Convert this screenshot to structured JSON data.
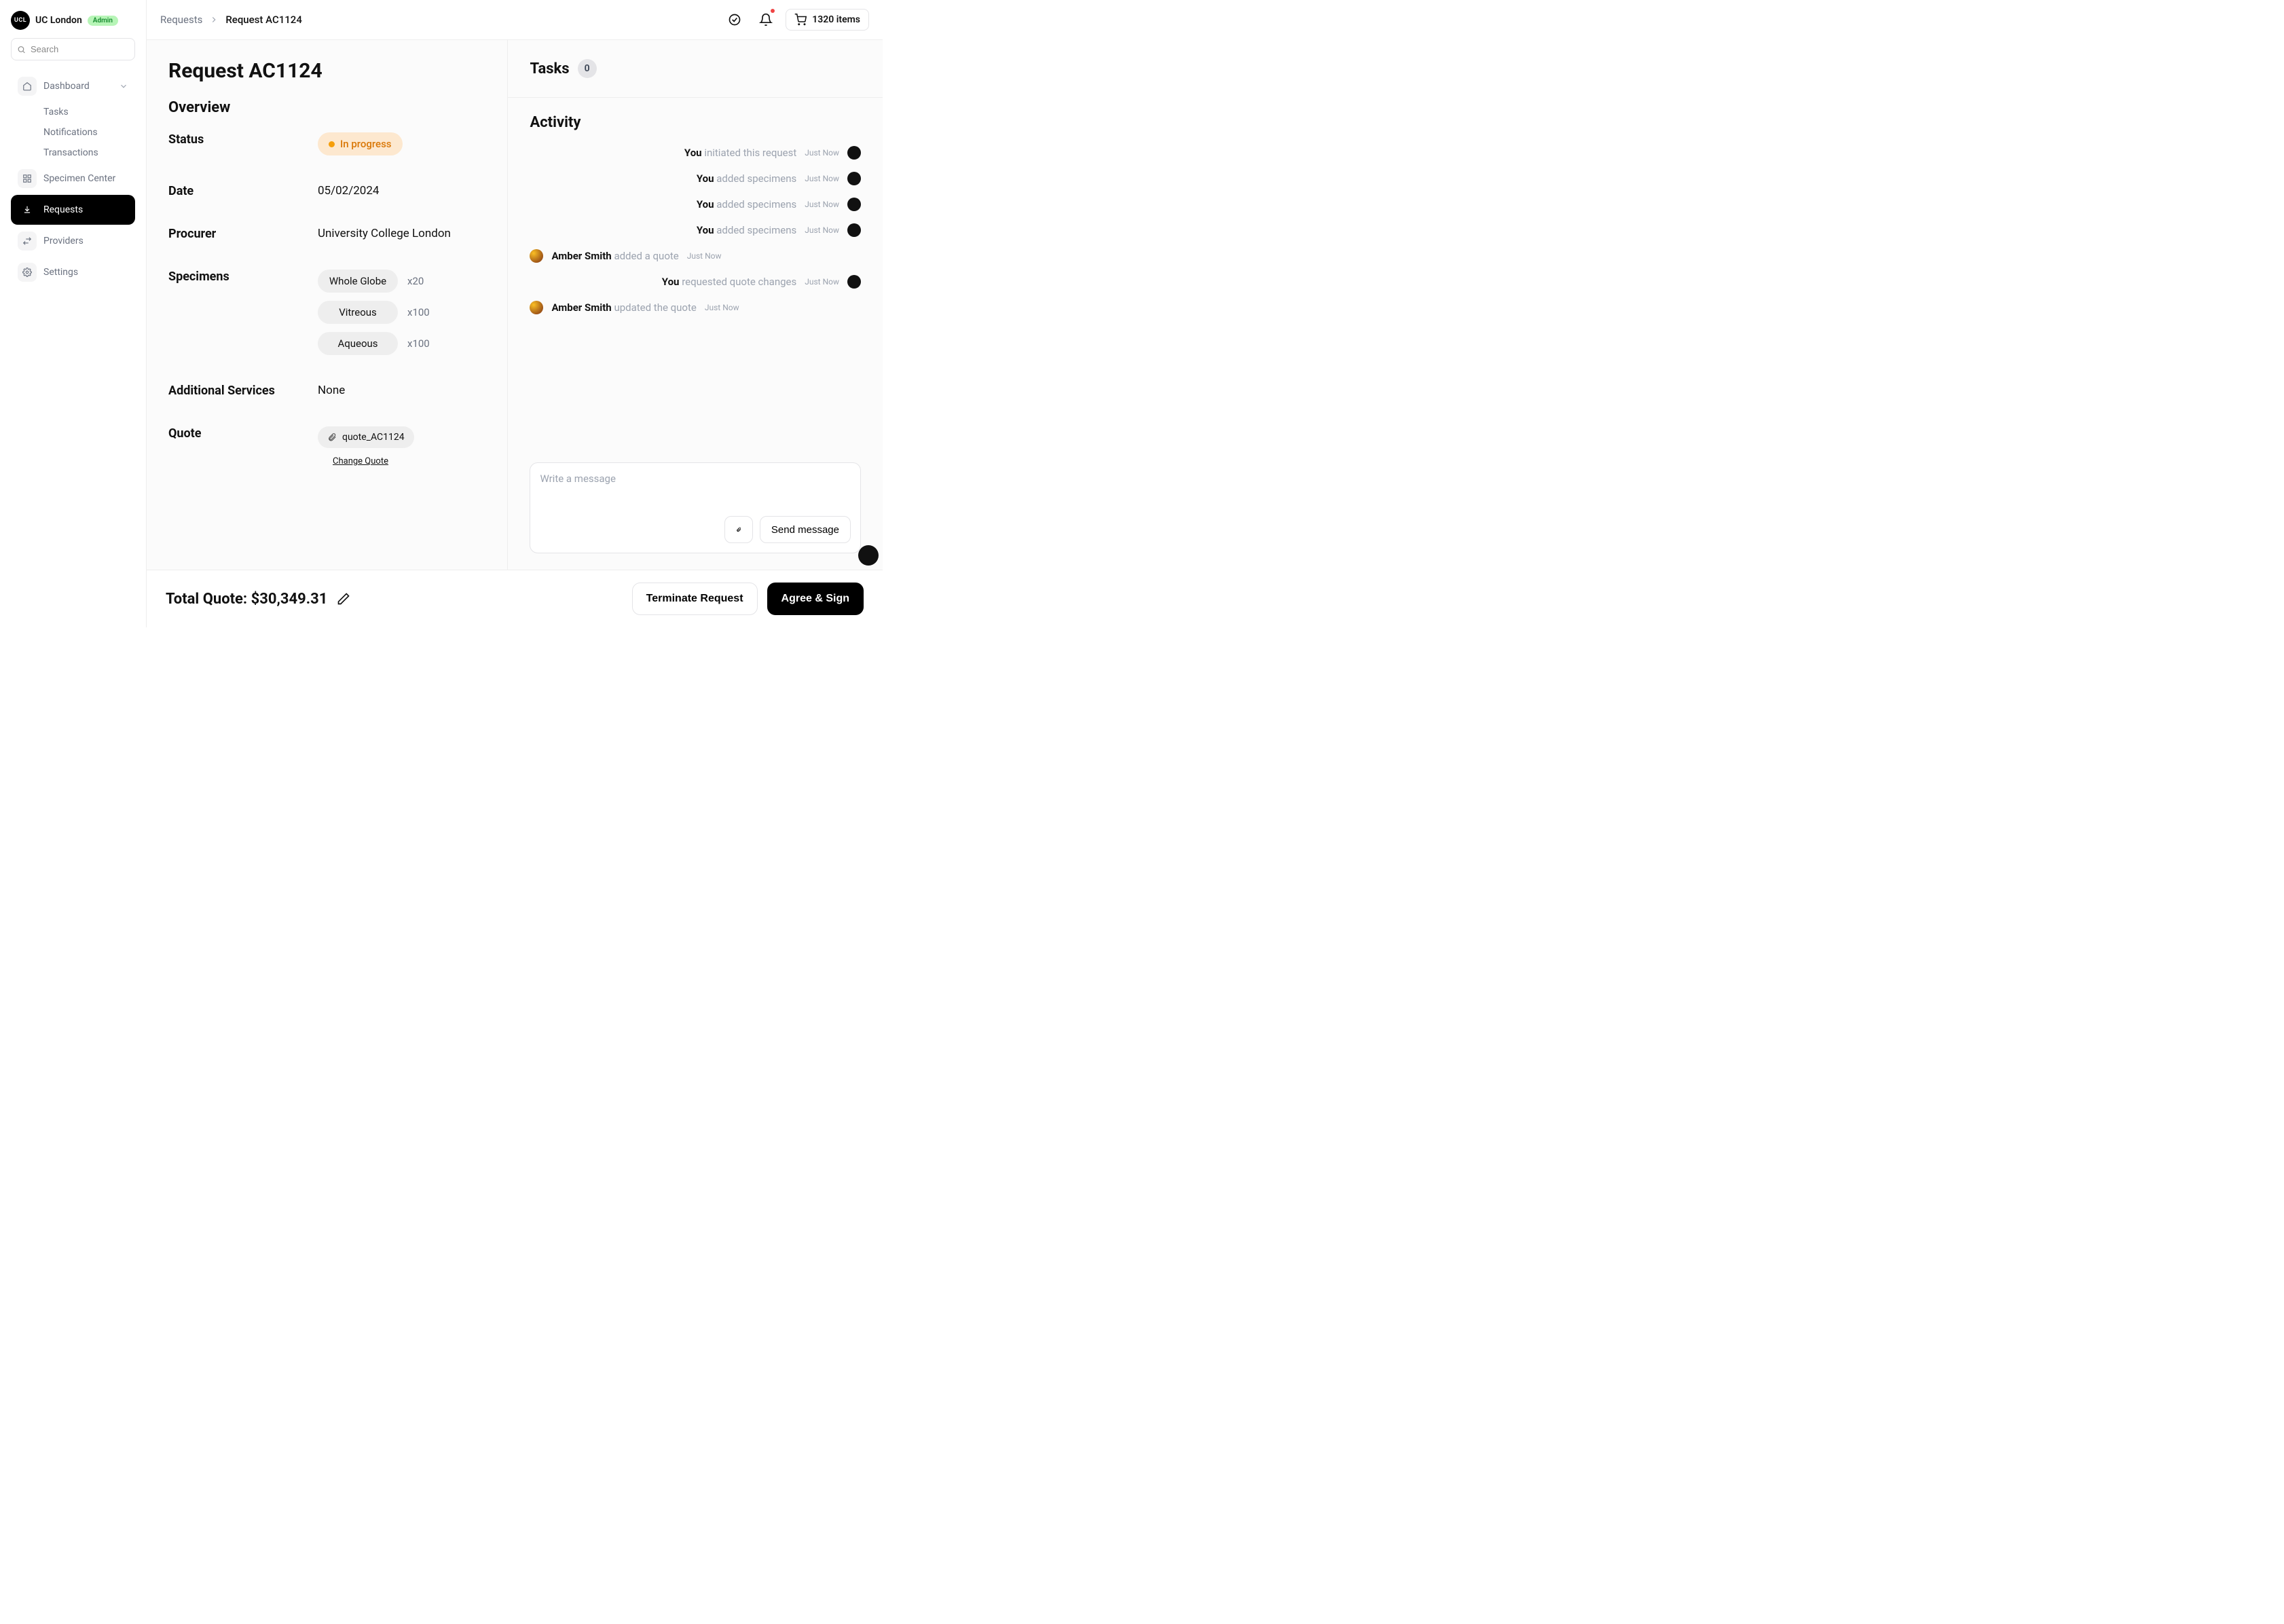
{
  "org": {
    "name": "UC London",
    "logo_text": "UCL",
    "role_badge": "Admin"
  },
  "search": {
    "placeholder": "Search"
  },
  "sidebar": {
    "dashboard": {
      "label": "Dashboard",
      "children": [
        "Tasks",
        "Notifications",
        "Transactions"
      ]
    },
    "specimen_center": "Specimen Center",
    "requests": "Requests",
    "providers": "Providers",
    "settings": "Settings"
  },
  "breadcrumb": {
    "parent": "Requests",
    "current": "Request AC1124"
  },
  "cart": {
    "label": "1320 items"
  },
  "page": {
    "title": "Request AC1124",
    "overview": "Overview"
  },
  "overview": {
    "status_label": "Status",
    "status_value": "In progress",
    "date_label": "Date",
    "date_value": "05/02/2024",
    "procurer_label": "Procurer",
    "procurer_value": "University College London",
    "specimens_label": "Specimens",
    "specimens": [
      {
        "name": "Whole Globe",
        "qty": "x20"
      },
      {
        "name": "Vitreous",
        "qty": "x100"
      },
      {
        "name": "Aqueous",
        "qty": "x100"
      }
    ],
    "services_label": "Additional Services",
    "services_value": "None",
    "quote_label": "Quote",
    "quote_file": "quote_AC1124",
    "change_quote": "Change Quote"
  },
  "tasks": {
    "title": "Tasks",
    "count": "0"
  },
  "activity": {
    "title": "Activity",
    "items": [
      {
        "side": "right",
        "actor": "You",
        "action": "initiated this request",
        "time": "Just Now"
      },
      {
        "side": "right",
        "actor": "You",
        "action": "added specimens",
        "time": "Just Now"
      },
      {
        "side": "right",
        "actor": "You",
        "action": "added specimens",
        "time": "Just Now"
      },
      {
        "side": "right",
        "actor": "You",
        "action": "added specimens",
        "time": "Just Now"
      },
      {
        "side": "left",
        "actor": "Amber Smith",
        "action": "added a quote",
        "time": "Just Now"
      },
      {
        "side": "right",
        "actor": "You",
        "action": "requested quote changes",
        "time": "Just Now"
      },
      {
        "side": "left",
        "actor": "Amber Smith",
        "action": "updated the quote",
        "time": "Just Now"
      }
    ],
    "compose_placeholder": "Write a message",
    "send_label": "Send message"
  },
  "footer": {
    "total_prefix": "Total Quote: ",
    "total_amount": "$30,349.31",
    "terminate": "Terminate Request",
    "agree": "Agree & Sign"
  }
}
